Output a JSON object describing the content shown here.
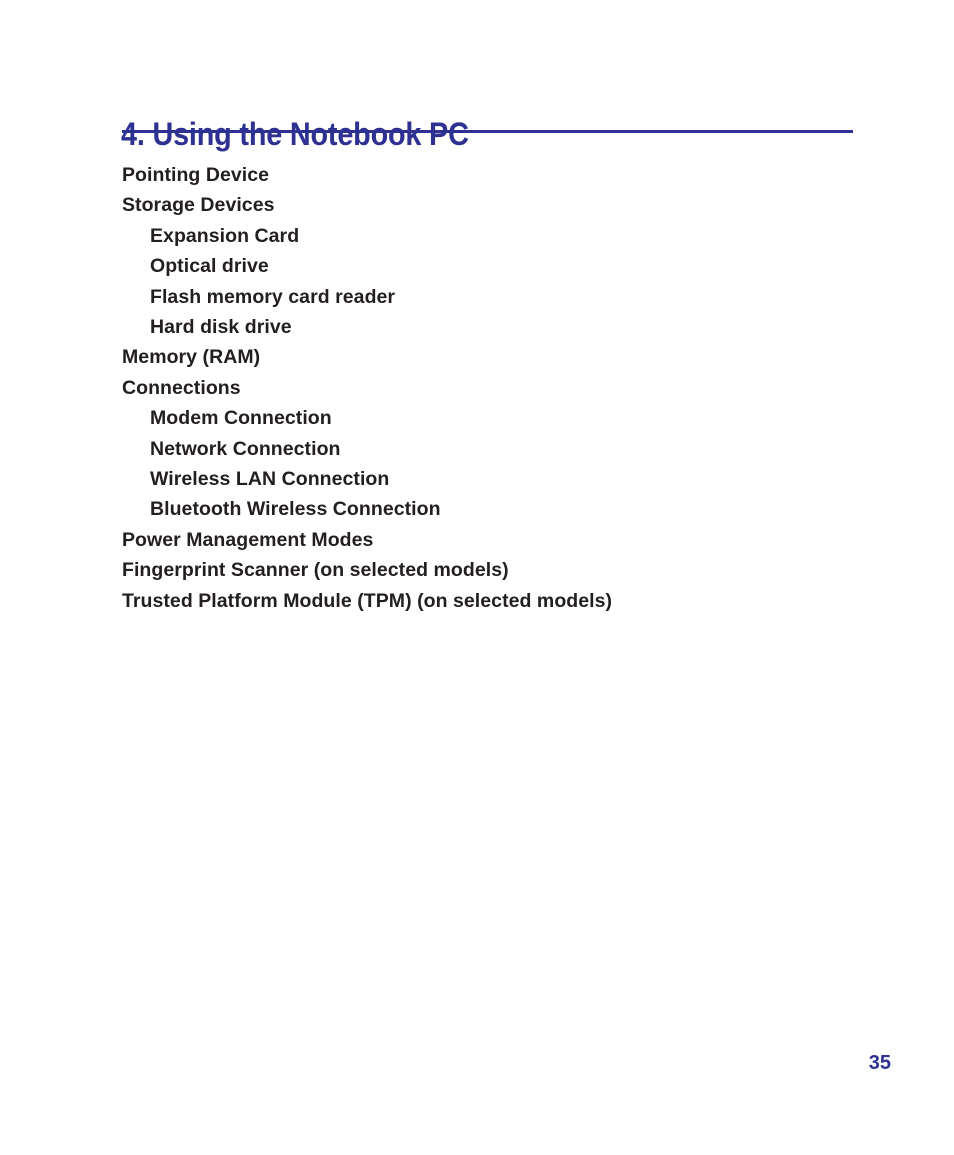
{
  "page": {
    "background_color": "#ffffff",
    "accent_color": "#2e3192",
    "text_color": "#231f20",
    "number": "35"
  },
  "header": {
    "title": "4. Using the Notebook PC"
  },
  "contents": {
    "items": [
      {
        "label": "Pointing Device",
        "level": 1
      },
      {
        "label": "Storage Devices",
        "level": 1
      },
      {
        "label": "Expansion Card",
        "level": 2
      },
      {
        "label": "Optical drive",
        "level": 2
      },
      {
        "label": "Flash memory card reader",
        "level": 2
      },
      {
        "label": "Hard disk drive",
        "level": 2
      },
      {
        "label": "Memory (RAM)",
        "level": 1
      },
      {
        "label": "Connections",
        "level": 1
      },
      {
        "label": "Modem Connection",
        "level": 2
      },
      {
        "label": "Network Connection",
        "level": 2
      },
      {
        "label": "Wireless LAN Connection",
        "level": 2
      },
      {
        "label": "Bluetooth Wireless Connection",
        "level": 2
      },
      {
        "label": "Power Management Modes",
        "level": 1
      },
      {
        "label": "Fingerprint Scanner (on selected models)",
        "level": 1
      },
      {
        "label": "Trusted Platform Module (TPM) (on selected models)",
        "level": 1
      }
    ]
  }
}
